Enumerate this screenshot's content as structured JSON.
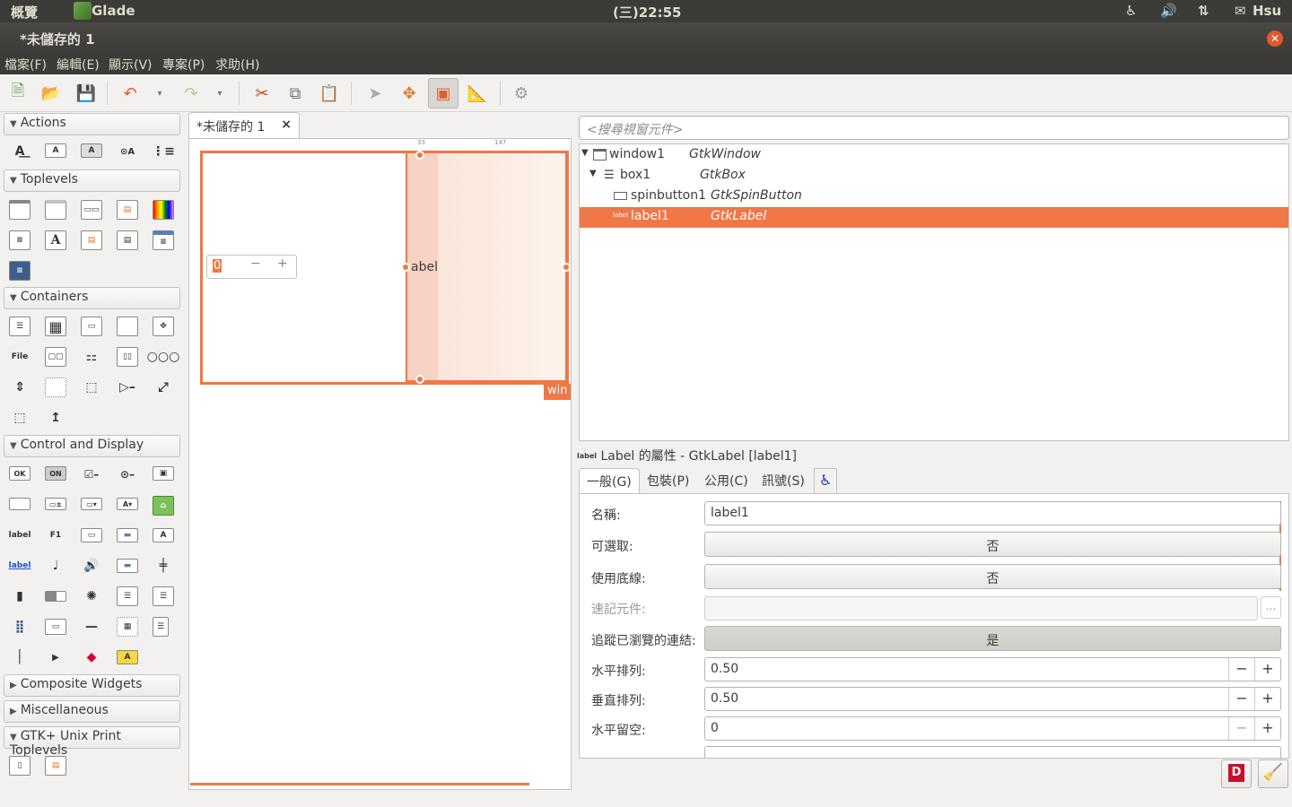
{
  "panel": {
    "overview": "概覽",
    "app": "Glade",
    "clock": "(三)22:55",
    "user": "Hsu"
  },
  "window": {
    "title": "*未儲存的 1"
  },
  "menu": [
    "檔案(F)",
    "編輯(E)",
    "顯示(V)",
    "專案(P)",
    "求助(H)"
  ],
  "palette": {
    "sections": [
      "Actions",
      "Toplevels",
      "Containers",
      "Control and Display",
      "Composite Widgets",
      "Miscellaneous",
      "GTK+ Unix Print Toplevels"
    ],
    "widget_glyphs": {
      "file": "File",
      "ok": "OK",
      "on": "ON",
      "f1": "F1",
      "label": "label",
      "a": "A"
    }
  },
  "document": {
    "tab_label": "*未儲存的 1",
    "close_glyph": "×",
    "spin_value": "0",
    "label_text": "abel",
    "window_tag": "win",
    "ruler_left": "33",
    "ruler_right": "147"
  },
  "inspector": {
    "search_placeholder": "<搜尋視窗元件>",
    "tree": [
      {
        "name": "window1",
        "type": "GtkWindow"
      },
      {
        "name": "box1",
        "type": "GtkBox"
      },
      {
        "name": "spinbutton1",
        "type": "GtkSpinButton"
      },
      {
        "name": "label1",
        "type": "GtkLabel",
        "selected": true
      }
    ]
  },
  "properties": {
    "icon_text": "label",
    "title": "Label 的屬性 - GtkLabel [label1]",
    "tabs": [
      "一般(G)",
      "包裝(P)",
      "公用(C)",
      "訊號(S)"
    ],
    "rows": {
      "name": {
        "label": "名稱:",
        "value": "label1"
      },
      "selectable": {
        "label": "可選取:",
        "value": "否"
      },
      "underline": {
        "label": "使用底線:",
        "value": "否"
      },
      "mnemonic": {
        "label": "速記元件:",
        "value": "",
        "button": "..."
      },
      "track": {
        "label": "追蹤已瀏覽的連結:",
        "value": "是"
      },
      "xalign": {
        "label": "水平排列:",
        "value": "0.50"
      },
      "yalign": {
        "label": "垂直排列:",
        "value": "0.50"
      },
      "xpad": {
        "label": "水平留空:",
        "value": "0"
      }
    }
  },
  "colors": {
    "accent": "#f07746",
    "panel": "#3c3b37",
    "close": "#e05a2b"
  }
}
